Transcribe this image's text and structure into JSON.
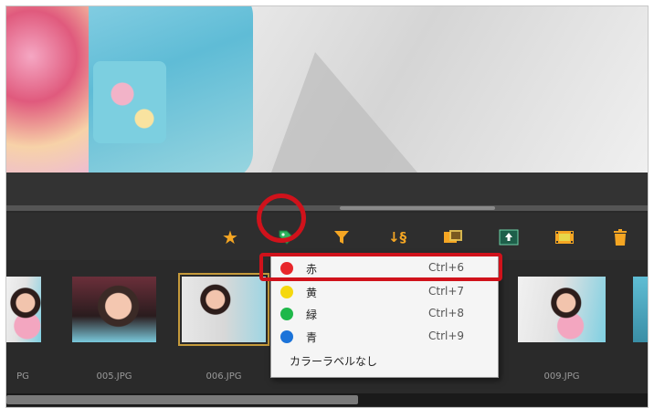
{
  "toolbar": {
    "icons": [
      "star-icon",
      "color-label-tag-icon",
      "filter-icon",
      "sort-icon",
      "compare-icon",
      "export-icon",
      "filmstrip-icon",
      "trash-icon"
    ],
    "accent_color": "#f5a623",
    "active_icon_color": "#2db35d"
  },
  "color_label_menu": {
    "items": [
      {
        "label": "赤",
        "shortcut": "Ctrl+6",
        "color": "#e8262b"
      },
      {
        "label": "黄",
        "shortcut": "Ctrl+7",
        "color": "#f5d80f"
      },
      {
        "label": "緑",
        "shortcut": "Ctrl+8",
        "color": "#1fb84a"
      },
      {
        "label": "青",
        "shortcut": "Ctrl+9",
        "color": "#1b73d9"
      },
      {
        "label": "カラーラベルなし"
      }
    ],
    "highlight_color": "#d0121b"
  },
  "thumbnails": {
    "filenames": [
      "PG",
      "005.JPG",
      "006.JPG",
      "009.JPG"
    ],
    "selected": "006.JPG"
  }
}
